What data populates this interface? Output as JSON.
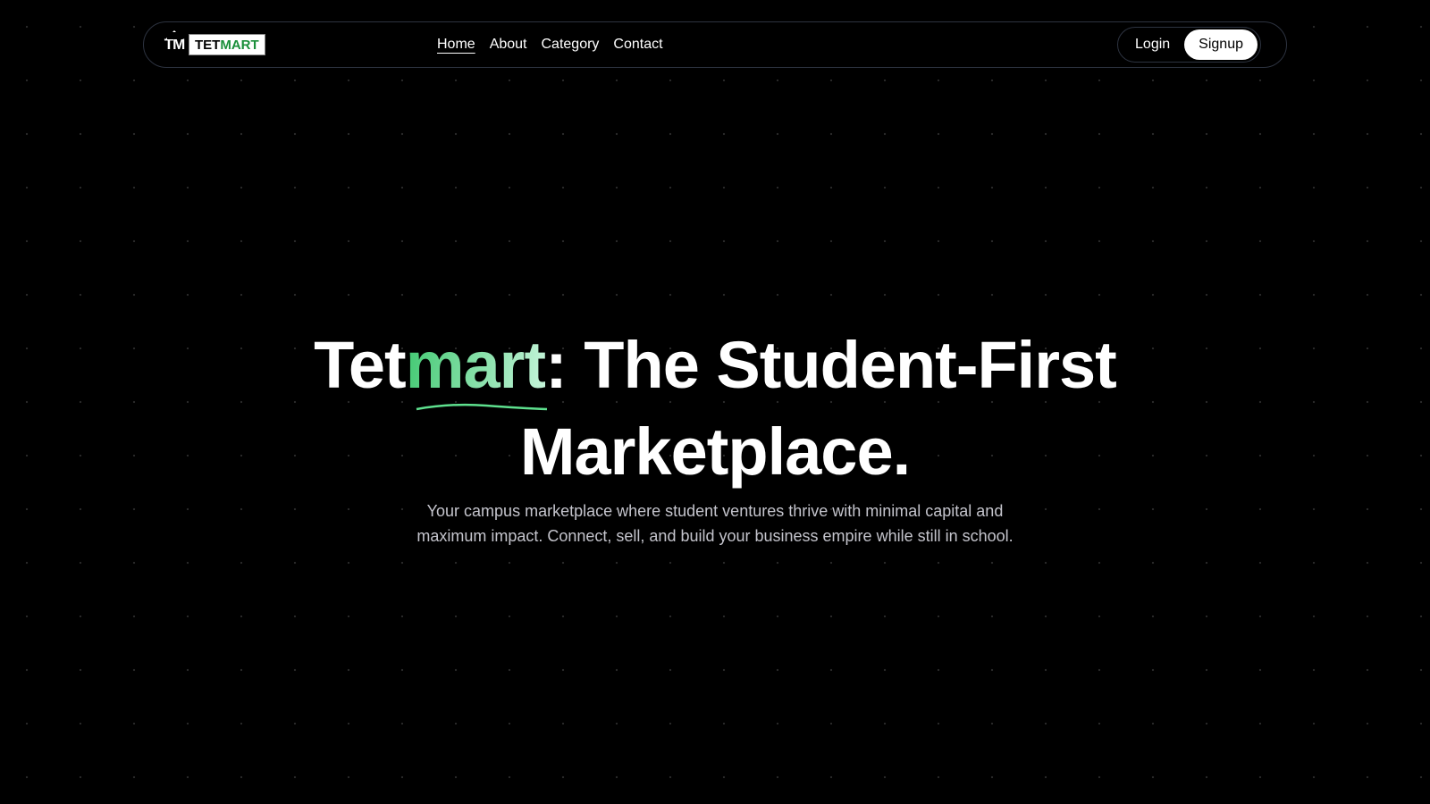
{
  "nav": {
    "logo_mark": "TM",
    "logo_text_a": "TET",
    "logo_text_b": "MART",
    "links": [
      {
        "label": "Home"
      },
      {
        "label": "About"
      },
      {
        "label": "Category"
      },
      {
        "label": "Contact"
      }
    ],
    "login": "Login",
    "signup": "Signup"
  },
  "hero": {
    "title_a": "Tet",
    "title_highlight": "mart",
    "title_b": ": The Student-First",
    "title_c": "Marketplace.",
    "subtitle_1": "Your campus marketplace where student ventures thrive with minimal capital and",
    "subtitle_2": "maximum impact. Connect, sell, and build your business empire while still in school."
  },
  "colors": {
    "accent": "#4ade80",
    "background": "#000000"
  }
}
